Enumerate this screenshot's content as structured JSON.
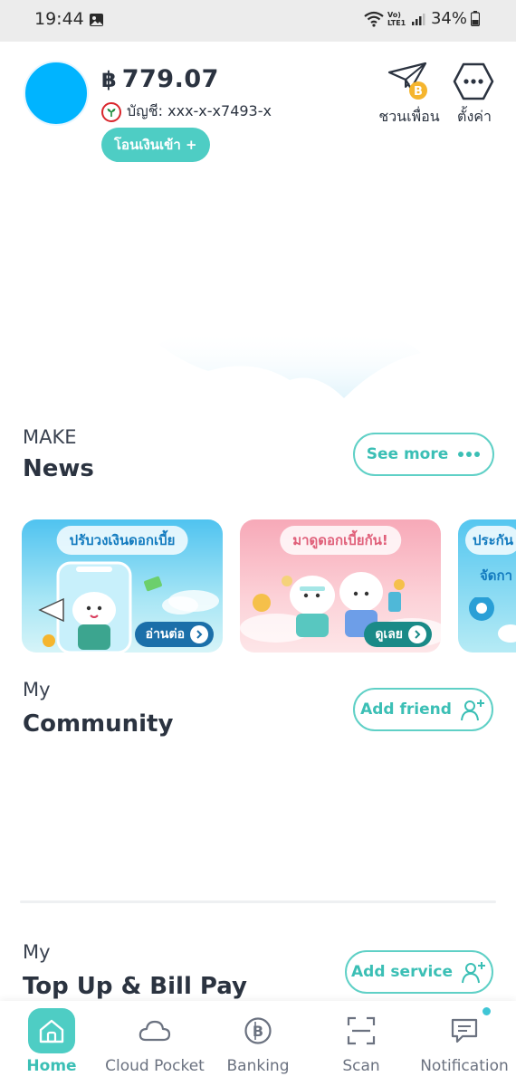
{
  "status_bar": {
    "time": "19:44",
    "network": "Vo) LTE1",
    "battery": "34%"
  },
  "header": {
    "currency_symbol": "฿",
    "balance": "779.07",
    "account_label": "บัญชี: xxx-x-x7493-x",
    "transfer_button": "โอนเงินเข้า +",
    "invite_label": "ชวนเพื่อน",
    "settings_label": "ตั้งค่า",
    "avatar_color": "#00b4ff",
    "accent": "#4ecdc4"
  },
  "news_section": {
    "kicker": "MAKE",
    "title": "News",
    "see_more": "See more",
    "cards": [
      {
        "tag": "ปรับวงเงินดอกเบี้ย",
        "cta": "อ่านต่อ"
      },
      {
        "tag": "มาดูดอกเบี้ยกัน!",
        "cta": "ดูเลย"
      },
      {
        "tag": "ประกัน",
        "subtitle": "จัดกา"
      }
    ]
  },
  "community_section": {
    "kicker": "My",
    "title": "Community",
    "add_friend": "Add friend"
  },
  "topup_section": {
    "kicker": "My",
    "title": "Top Up & Bill Pay",
    "add_service": "Add service"
  },
  "bottom_nav": {
    "items": [
      {
        "label": "Home",
        "icon": "home-icon",
        "active": true
      },
      {
        "label": "Cloud Pocket",
        "icon": "cloud-icon",
        "active": false
      },
      {
        "label": "Banking",
        "icon": "baht-coin-icon",
        "active": false
      },
      {
        "label": "Scan",
        "icon": "scan-icon",
        "active": false
      },
      {
        "label": "Notification",
        "icon": "chat-bubble-icon",
        "active": false
      }
    ]
  }
}
